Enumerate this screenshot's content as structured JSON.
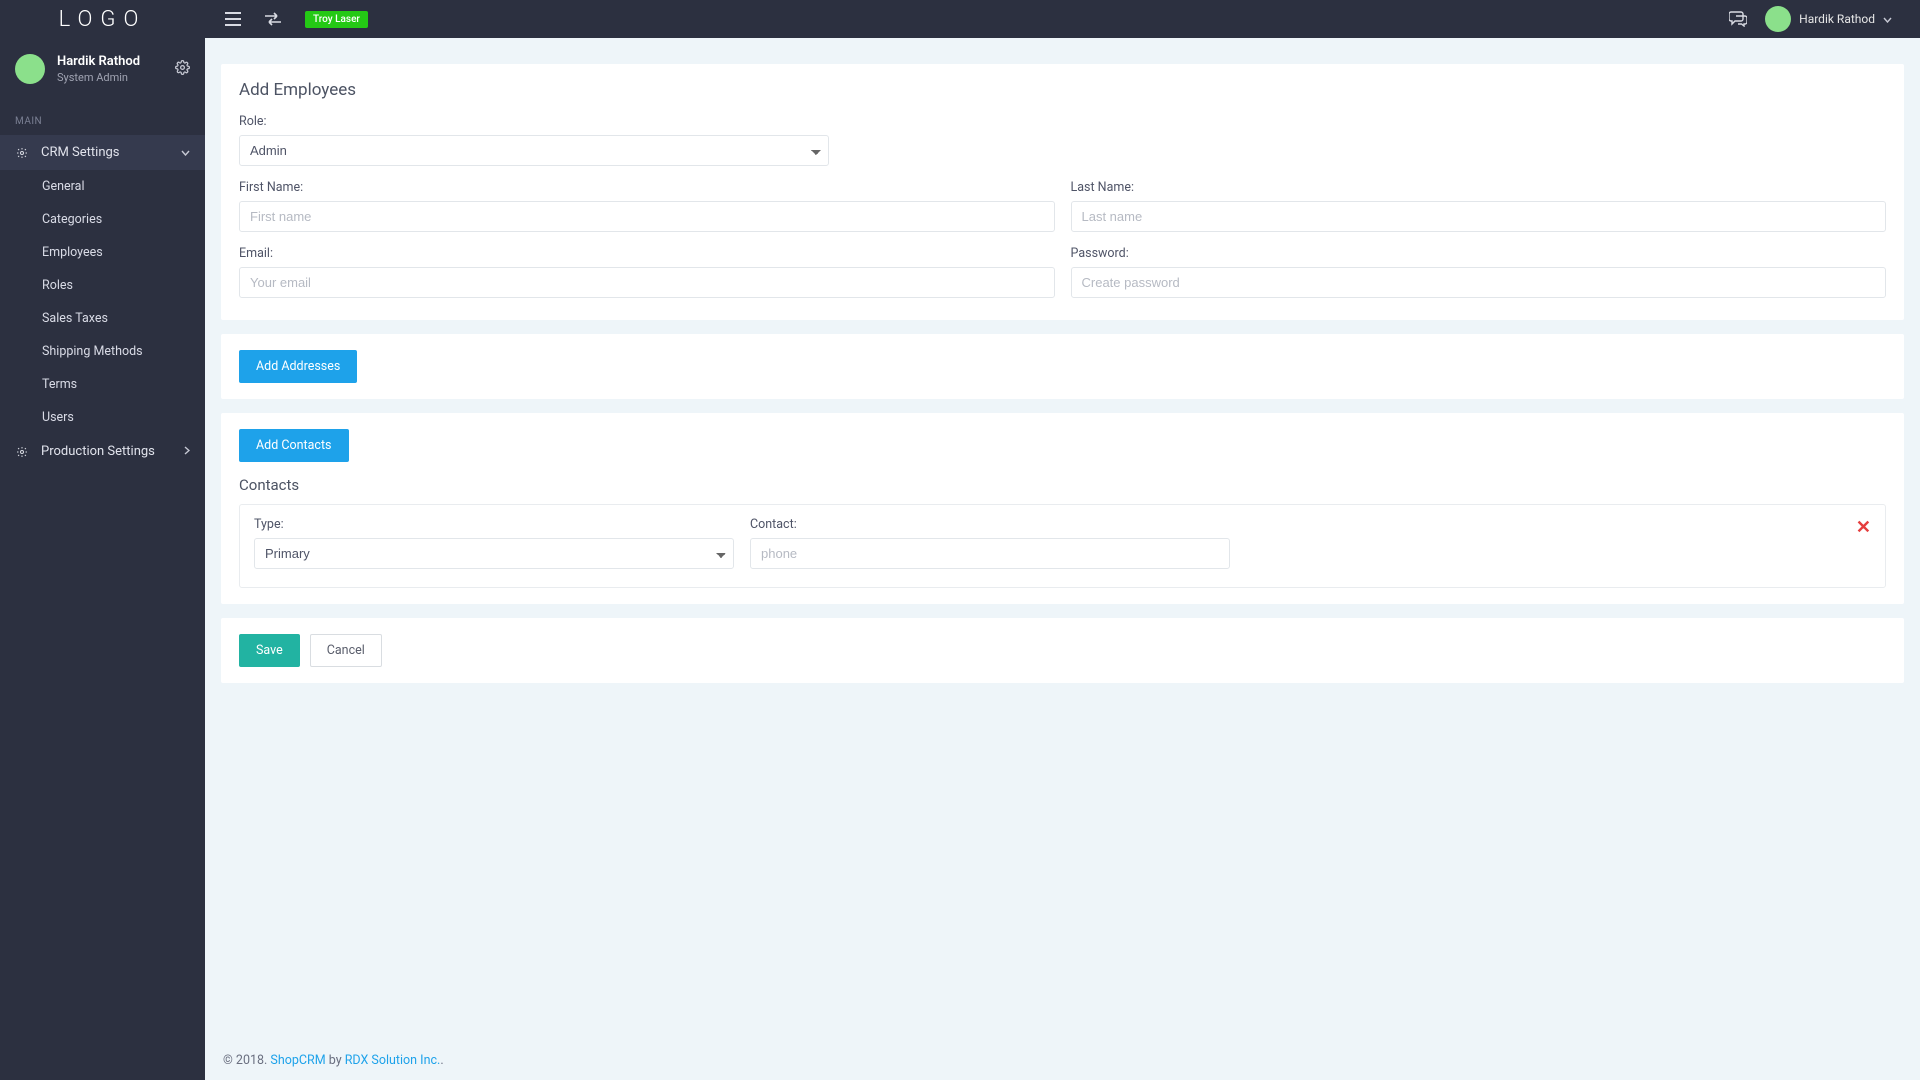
{
  "brand": {
    "logo_text": "LOGO"
  },
  "header": {
    "badge": "Troy Laser",
    "user_name": "Hardik Rathod"
  },
  "sidebar": {
    "user": {
      "name": "Hardik Rathod",
      "role": "System Admin"
    },
    "section_label": "MAIN",
    "crm_label": "CRM Settings",
    "crm_items": [
      {
        "label": "General"
      },
      {
        "label": "Categories"
      },
      {
        "label": "Employees"
      },
      {
        "label": "Roles"
      },
      {
        "label": "Sales Taxes"
      },
      {
        "label": "Shipping Methods"
      },
      {
        "label": "Terms"
      },
      {
        "label": "Users"
      }
    ],
    "prod_label": "Production Settings"
  },
  "page": {
    "title": "Add Employees",
    "role_label": "Role:",
    "role_value": "Admin",
    "first_name_label": "First Name:",
    "first_name_ph": "First name",
    "last_name_label": "Last Name:",
    "last_name_ph": "Last name",
    "email_label": "Email:",
    "email_ph": "Your email",
    "password_label": "Password:",
    "password_ph": "Create password",
    "add_addresses_label": "Add Addresses",
    "add_contacts_label": "Add Contacts",
    "contacts_heading": "Contacts",
    "contact_type_label": "Type:",
    "contact_type_value": "Primary",
    "contact_label": "Contact:",
    "contact_ph": "phone",
    "save_label": "Save",
    "cancel_label": "Cancel"
  },
  "footer": {
    "copyright_prefix": "© 2018. ",
    "app_name": "ShopCRM",
    "by": " by ",
    "company": "RDX Solution Inc.",
    "suffix": "."
  }
}
